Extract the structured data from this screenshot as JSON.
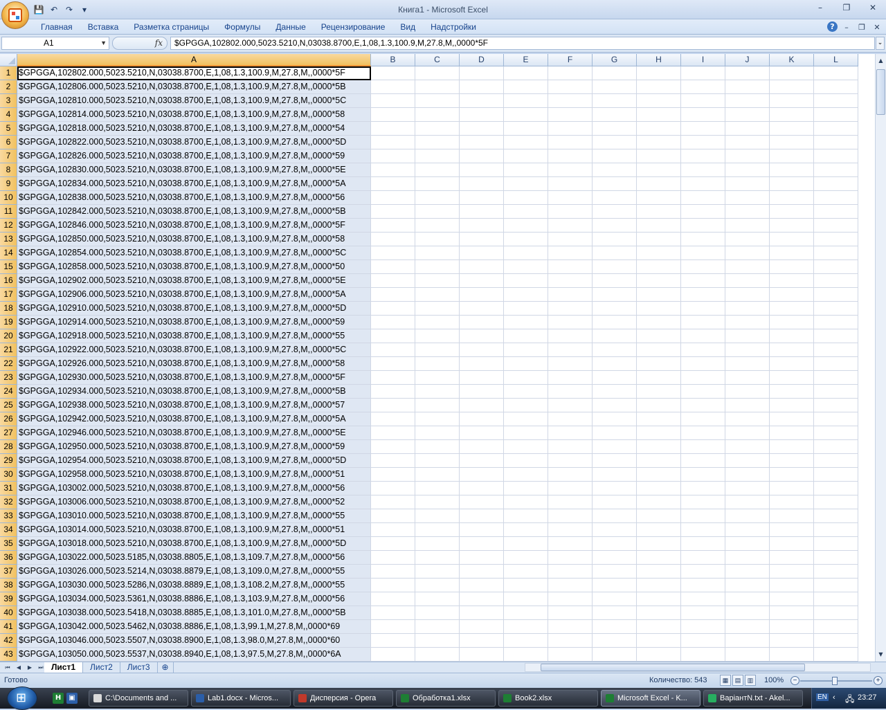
{
  "window": {
    "title": "Книга1 - Microsoft Excel",
    "minimize": "–",
    "maximize": "❐",
    "close": "✕"
  },
  "qat": {
    "save_icon": "💾",
    "undo_icon": "↶",
    "redo_icon": "↷",
    "customize_icon": "▾"
  },
  "ribbon": {
    "tabs": [
      "Главная",
      "Вставка",
      "Разметка страницы",
      "Формулы",
      "Данные",
      "Рецензирование",
      "Вид",
      "Надстройки"
    ],
    "help": "?",
    "min": "–",
    "restore": "❐",
    "close": "✕"
  },
  "formula_bar": {
    "name_box": "A1",
    "fx": "fx",
    "formula": "$GPGGA,102802.000,5023.5210,N,03038.8700,E,1,08,1.3,100.9,M,27.8,M,,0000*5F"
  },
  "columns": [
    "A",
    "B",
    "C",
    "D",
    "E",
    "F",
    "G",
    "H",
    "I",
    "J",
    "K",
    "L"
  ],
  "rows": [
    {
      "n": "1",
      "a": "$GPGGA,102802.000,5023.5210,N,03038.8700,E,1,08,1.3,100.9,M,27.8,M,,0000*5F"
    },
    {
      "n": "2",
      "a": "$GPGGA,102806.000,5023.5210,N,03038.8700,E,1,08,1.3,100.9,M,27.8,M,,0000*5B"
    },
    {
      "n": "3",
      "a": "$GPGGA,102810.000,5023.5210,N,03038.8700,E,1,08,1.3,100.9,M,27.8,M,,0000*5C"
    },
    {
      "n": "4",
      "a": "$GPGGA,102814.000,5023.5210,N,03038.8700,E,1,08,1.3,100.9,M,27.8,M,,0000*58"
    },
    {
      "n": "5",
      "a": "$GPGGA,102818.000,5023.5210,N,03038.8700,E,1,08,1.3,100.9,M,27.8,M,,0000*54"
    },
    {
      "n": "6",
      "a": "$GPGGA,102822.000,5023.5210,N,03038.8700,E,1,08,1.3,100.9,M,27.8,M,,0000*5D"
    },
    {
      "n": "7",
      "a": "$GPGGA,102826.000,5023.5210,N,03038.8700,E,1,08,1.3,100.9,M,27.8,M,,0000*59"
    },
    {
      "n": "8",
      "a": "$GPGGA,102830.000,5023.5210,N,03038.8700,E,1,08,1.3,100.9,M,27.8,M,,0000*5E"
    },
    {
      "n": "9",
      "a": "$GPGGA,102834.000,5023.5210,N,03038.8700,E,1,08,1.3,100.9,M,27.8,M,,0000*5A"
    },
    {
      "n": "10",
      "a": "$GPGGA,102838.000,5023.5210,N,03038.8700,E,1,08,1.3,100.9,M,27.8,M,,0000*56"
    },
    {
      "n": "11",
      "a": "$GPGGA,102842.000,5023.5210,N,03038.8700,E,1,08,1.3,100.9,M,27.8,M,,0000*5B"
    },
    {
      "n": "12",
      "a": "$GPGGA,102846.000,5023.5210,N,03038.8700,E,1,08,1.3,100.9,M,27.8,M,,0000*5F"
    },
    {
      "n": "13",
      "a": "$GPGGA,102850.000,5023.5210,N,03038.8700,E,1,08,1.3,100.9,M,27.8,M,,0000*58"
    },
    {
      "n": "14",
      "a": "$GPGGA,102854.000,5023.5210,N,03038.8700,E,1,08,1.3,100.9,M,27.8,M,,0000*5C"
    },
    {
      "n": "15",
      "a": "$GPGGA,102858.000,5023.5210,N,03038.8700,E,1,08,1.3,100.9,M,27.8,M,,0000*50"
    },
    {
      "n": "16",
      "a": "$GPGGA,102902.000,5023.5210,N,03038.8700,E,1,08,1.3,100.9,M,27.8,M,,0000*5E"
    },
    {
      "n": "17",
      "a": "$GPGGA,102906.000,5023.5210,N,03038.8700,E,1,08,1.3,100.9,M,27.8,M,,0000*5A"
    },
    {
      "n": "18",
      "a": "$GPGGA,102910.000,5023.5210,N,03038.8700,E,1,08,1.3,100.9,M,27.8,M,,0000*5D"
    },
    {
      "n": "19",
      "a": "$GPGGA,102914.000,5023.5210,N,03038.8700,E,1,08,1.3,100.9,M,27.8,M,,0000*59"
    },
    {
      "n": "20",
      "a": "$GPGGA,102918.000,5023.5210,N,03038.8700,E,1,08,1.3,100.9,M,27.8,M,,0000*55"
    },
    {
      "n": "21",
      "a": "$GPGGA,102922.000,5023.5210,N,03038.8700,E,1,08,1.3,100.9,M,27.8,M,,0000*5C"
    },
    {
      "n": "22",
      "a": "$GPGGA,102926.000,5023.5210,N,03038.8700,E,1,08,1.3,100.9,M,27.8,M,,0000*58"
    },
    {
      "n": "23",
      "a": "$GPGGA,102930.000,5023.5210,N,03038.8700,E,1,08,1.3,100.9,M,27.8,M,,0000*5F"
    },
    {
      "n": "24",
      "a": "$GPGGA,102934.000,5023.5210,N,03038.8700,E,1,08,1.3,100.9,M,27.8,M,,0000*5B"
    },
    {
      "n": "25",
      "a": "$GPGGA,102938.000,5023.5210,N,03038.8700,E,1,08,1.3,100.9,M,27.8,M,,0000*57"
    },
    {
      "n": "26",
      "a": "$GPGGA,102942.000,5023.5210,N,03038.8700,E,1,08,1.3,100.9,M,27.8,M,,0000*5A"
    },
    {
      "n": "27",
      "a": "$GPGGA,102946.000,5023.5210,N,03038.8700,E,1,08,1.3,100.9,M,27.8,M,,0000*5E"
    },
    {
      "n": "28",
      "a": "$GPGGA,102950.000,5023.5210,N,03038.8700,E,1,08,1.3,100.9,M,27.8,M,,0000*59"
    },
    {
      "n": "29",
      "a": "$GPGGA,102954.000,5023.5210,N,03038.8700,E,1,08,1.3,100.9,M,27.8,M,,0000*5D"
    },
    {
      "n": "30",
      "a": "$GPGGA,102958.000,5023.5210,N,03038.8700,E,1,08,1.3,100.9,M,27.8,M,,0000*51"
    },
    {
      "n": "31",
      "a": "$GPGGA,103002.000,5023.5210,N,03038.8700,E,1,08,1.3,100.9,M,27.8,M,,0000*56"
    },
    {
      "n": "32",
      "a": "$GPGGA,103006.000,5023.5210,N,03038.8700,E,1,08,1.3,100.9,M,27.8,M,,0000*52"
    },
    {
      "n": "33",
      "a": "$GPGGA,103010.000,5023.5210,N,03038.8700,E,1,08,1.3,100.9,M,27.8,M,,0000*55"
    },
    {
      "n": "34",
      "a": "$GPGGA,103014.000,5023.5210,N,03038.8700,E,1,08,1.3,100.9,M,27.8,M,,0000*51"
    },
    {
      "n": "35",
      "a": "$GPGGA,103018.000,5023.5210,N,03038.8700,E,1,08,1.3,100.9,M,27.8,M,,0000*5D"
    },
    {
      "n": "36",
      "a": "$GPGGA,103022.000,5023.5185,N,03038.8805,E,1,08,1.3,109.7,M,27.8,M,,0000*56"
    },
    {
      "n": "37",
      "a": "$GPGGA,103026.000,5023.5214,N,03038.8879,E,1,08,1.3,109.0,M,27.8,M,,0000*55"
    },
    {
      "n": "38",
      "a": "$GPGGA,103030.000,5023.5286,N,03038.8889,E,1,08,1.3,108.2,M,27.8,M,,0000*55"
    },
    {
      "n": "39",
      "a": "$GPGGA,103034.000,5023.5361,N,03038.8886,E,1,08,1.3,103.9,M,27.8,M,,0000*56"
    },
    {
      "n": "40",
      "a": "$GPGGA,103038.000,5023.5418,N,03038.8885,E,1,08,1.3,101.0,M,27.8,M,,0000*5B"
    },
    {
      "n": "41",
      "a": "$GPGGA,103042.000,5023.5462,N,03038.8886,E,1,08,1.3,99.1,M,27.8,M,,0000*69"
    },
    {
      "n": "42",
      "a": "$GPGGA,103046.000,5023.5507,N,03038.8900,E,1,08,1.3,98.0,M,27.8,M,,0000*60"
    },
    {
      "n": "43",
      "a": "$GPGGA,103050.000,5023.5537,N,03038.8940,E,1,08,1.3,97.5,M,27.8,M,,0000*6A"
    }
  ],
  "sheet_tabs": [
    "Лист1",
    "Лист2",
    "Лист3"
  ],
  "status": {
    "ready": "Готово",
    "count": "Количество: 543",
    "zoom": "100%"
  },
  "taskbar": {
    "items": [
      {
        "label": "C:\\Documents and ...",
        "icon_color": "#d9d9d9"
      },
      {
        "label": "Lab1.docx - Micros...",
        "icon_color": "#2b5ea8"
      },
      {
        "label": "Дисперсия - Opera",
        "icon_color": "#c0392b"
      },
      {
        "label": "Обработка1.xlsx",
        "icon_color": "#1e7e34"
      },
      {
        "label": "Book2.xlsx",
        "icon_color": "#1e7e34"
      },
      {
        "label": "Microsoft Excel - K...",
        "icon_color": "#1e7e34"
      },
      {
        "label": "ВаріантN.txt - Akel...",
        "icon_color": "#27ae60"
      }
    ],
    "lang": "EN",
    "time": "23:27"
  }
}
